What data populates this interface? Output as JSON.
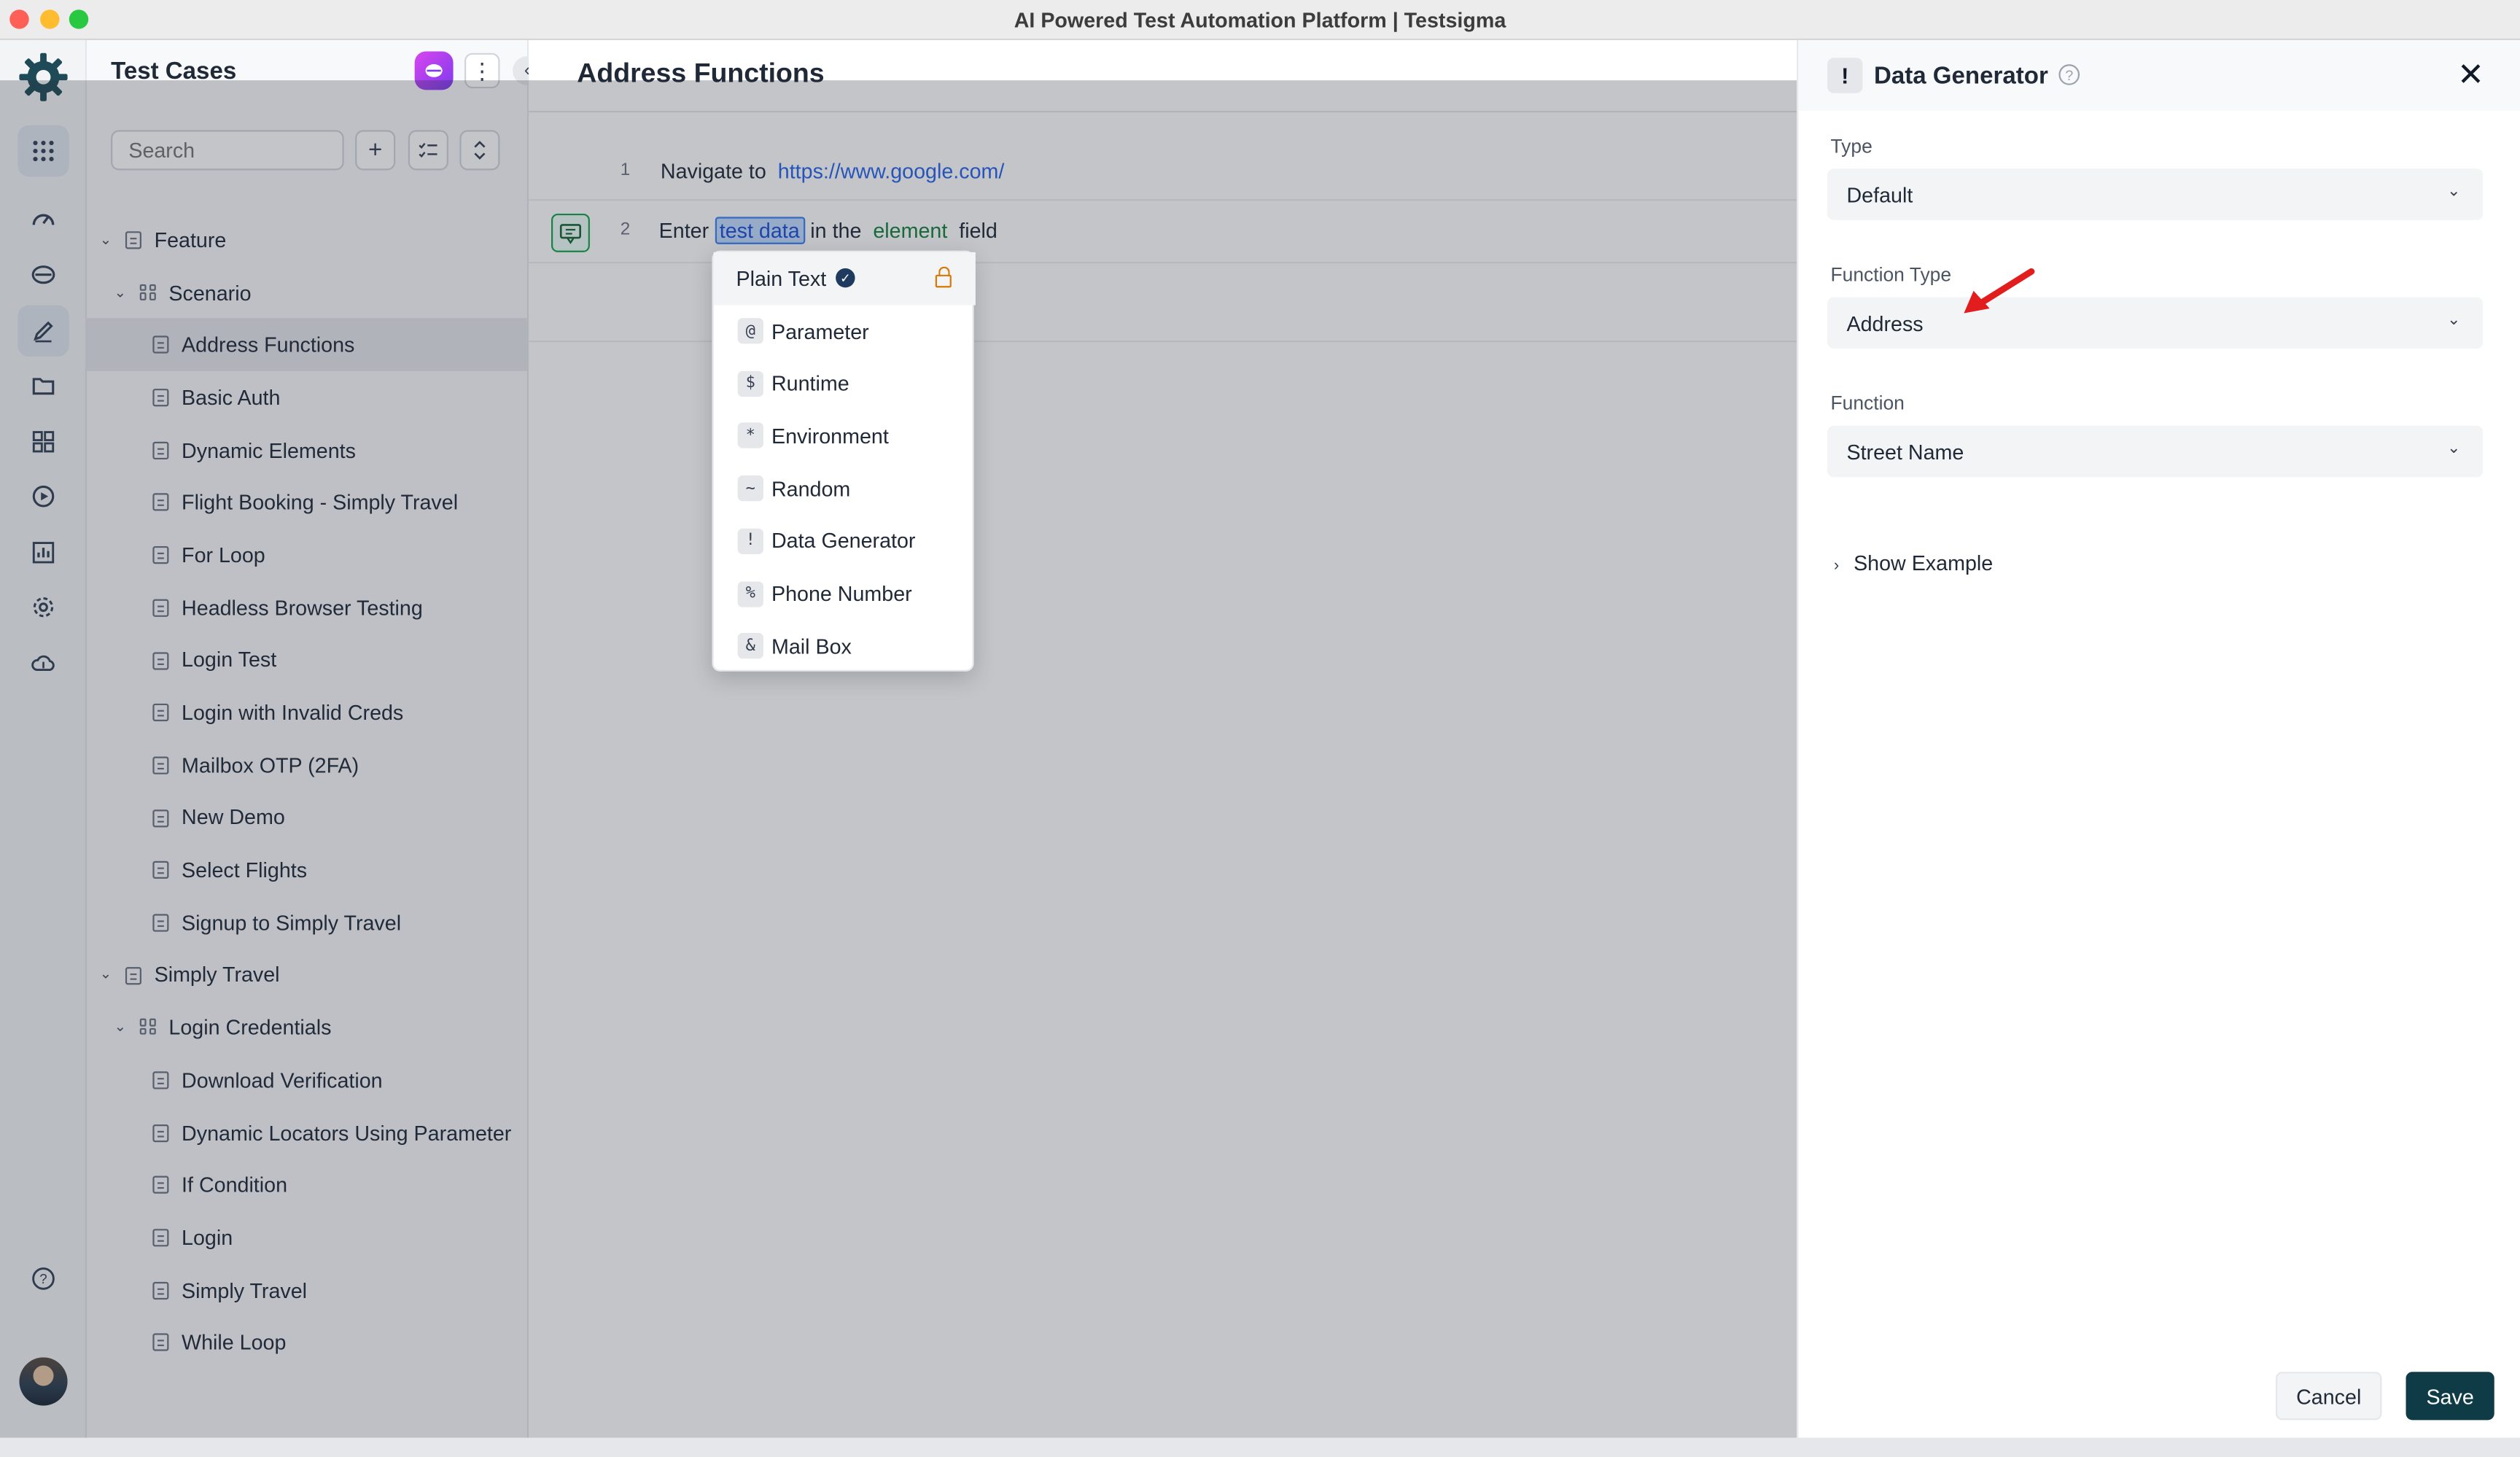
{
  "window": {
    "title": "AI Powered Test Automation Platform | Testsigma"
  },
  "rail": {
    "icons": [
      "testsigma-logo-icon",
      "apps-grid-icon",
      "dashboard-icon",
      "agent-icon",
      "edit-icon",
      "folder-icon",
      "modules-icon",
      "run-icon",
      "reports-icon",
      "settings-icon",
      "cloud-icon",
      "help-icon"
    ]
  },
  "sidebar": {
    "title": "Test Cases",
    "search_placeholder": "Search",
    "tree": [
      {
        "label": "Feature",
        "level": 0,
        "kind": "feature"
      },
      {
        "label": "Scenario",
        "level": 1,
        "kind": "scenario"
      },
      {
        "label": "Address Functions",
        "level": 2,
        "kind": "case",
        "selected": true
      },
      {
        "label": "Basic Auth",
        "level": 2,
        "kind": "case"
      },
      {
        "label": "Dynamic Elements",
        "level": 2,
        "kind": "case"
      },
      {
        "label": "Flight Booking - Simply Travel",
        "level": 2,
        "kind": "case"
      },
      {
        "label": "For Loop",
        "level": 2,
        "kind": "case"
      },
      {
        "label": "Headless Browser Testing",
        "level": 2,
        "kind": "case"
      },
      {
        "label": "Login Test",
        "level": 2,
        "kind": "case"
      },
      {
        "label": "Login with Invalid Creds",
        "level": 2,
        "kind": "case"
      },
      {
        "label": "Mailbox OTP (2FA)",
        "level": 2,
        "kind": "case"
      },
      {
        "label": "New Demo",
        "level": 2,
        "kind": "case"
      },
      {
        "label": "Select Flights",
        "level": 2,
        "kind": "case"
      },
      {
        "label": "Signup to Simply Travel",
        "level": 2,
        "kind": "case"
      },
      {
        "label": "Simply Travel",
        "level": 0,
        "kind": "feature"
      },
      {
        "label": "Login Credentials",
        "level": 1,
        "kind": "scenario"
      },
      {
        "label": "Download Verification",
        "level": 2,
        "kind": "case"
      },
      {
        "label": "Dynamic Locators Using Parameter",
        "level": 2,
        "kind": "case"
      },
      {
        "label": "If Condition",
        "level": 2,
        "kind": "case"
      },
      {
        "label": "Login",
        "level": 2,
        "kind": "case"
      },
      {
        "label": "Simply Travel",
        "level": 2,
        "kind": "case"
      },
      {
        "label": "While Loop",
        "level": 2,
        "kind": "case"
      }
    ]
  },
  "editor": {
    "title": "Address Functions",
    "steps": [
      {
        "num": "1",
        "action": "Navigate to",
        "url": "https://www.google.com/"
      },
      {
        "num": "2",
        "w1": "Enter",
        "data": "test data",
        "w2": "in the",
        "element": "element",
        "w3": "field"
      }
    ]
  },
  "data_type_menu": {
    "items": [
      {
        "symbol": "",
        "label": "Plain Text",
        "selected": true
      },
      {
        "symbol": "@",
        "label": "Parameter"
      },
      {
        "symbol": "$",
        "label": "Runtime"
      },
      {
        "symbol": "*",
        "label": "Environment"
      },
      {
        "symbol": "~",
        "label": "Random"
      },
      {
        "symbol": "!",
        "label": "Data Generator"
      },
      {
        "symbol": "%",
        "label": "Phone Number"
      },
      {
        "symbol": "&",
        "label": "Mail Box"
      }
    ]
  },
  "panel": {
    "icon_symbol": "!",
    "title": "Data Generator",
    "type_label": "Type",
    "type_value": "Default",
    "function_type_label": "Function Type",
    "function_type_value": "Address",
    "function_label": "Function",
    "function_value": "Street Name",
    "show_example": "Show Example",
    "cancel": "Cancel",
    "save": "Save"
  },
  "colors": {
    "accent": "#0f3b46",
    "link": "#2563eb",
    "element": "#15803d",
    "annotation_arrow": "#e11d1d"
  }
}
